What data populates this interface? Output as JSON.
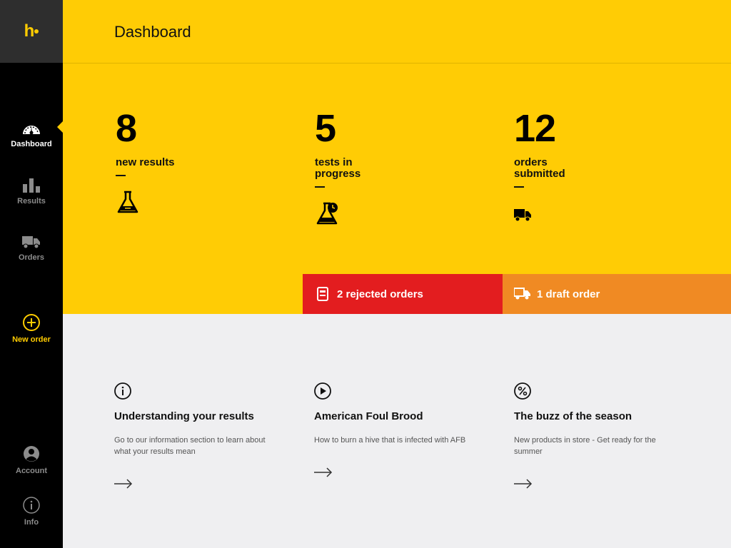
{
  "brand": {
    "logo_text": "h"
  },
  "colors": {
    "brand_yellow": "#ffcc05",
    "alert_red": "#e31d1f",
    "alert_orange": "#f08a23",
    "sidebar_bg": "#000000"
  },
  "sidebar": {
    "items": [
      {
        "label": "Dashboard",
        "icon": "gauge-icon"
      },
      {
        "label": "Results",
        "icon": "bar-chart-icon"
      },
      {
        "label": "Orders",
        "icon": "truck-icon"
      },
      {
        "label": "New order",
        "icon": "plus-circle-icon"
      },
      {
        "label": "Account",
        "icon": "user-icon"
      },
      {
        "label": "Info",
        "icon": "info-icon"
      }
    ]
  },
  "header": {
    "title": "Dashboard"
  },
  "stats": [
    {
      "value": "8",
      "label": "new results",
      "icon": "flask-icon"
    },
    {
      "value": "5",
      "label": "tests in progress",
      "icon": "flask-clock-icon"
    },
    {
      "value": "12",
      "label": "orders submitted",
      "icon": "truck-icon"
    }
  ],
  "alerts": [
    {
      "label": "2 rejected orders",
      "icon": "rejected-order-icon"
    },
    {
      "label": "1 draft order",
      "icon": "truck-icon"
    }
  ],
  "articles": [
    {
      "title": "Understanding your results",
      "description": "Go to our information section to learn about what your results mean",
      "icon": "info-icon"
    },
    {
      "title": "American Foul Brood",
      "description": "How to burn a hive that is infected with AFB",
      "icon": "play-icon"
    },
    {
      "title": "The buzz of the season",
      "description": "New products in store - Get ready for the summer",
      "icon": "percent-icon"
    }
  ]
}
